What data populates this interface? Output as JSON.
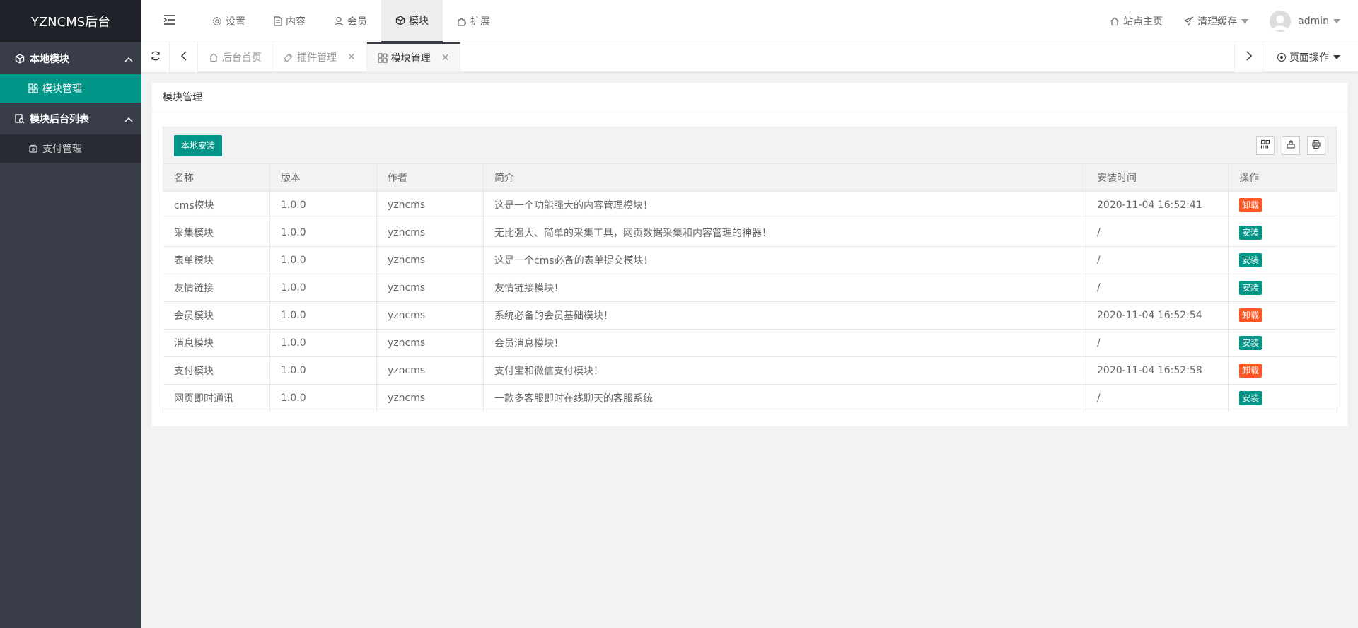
{
  "colors": {
    "accent": "#009688",
    "danger": "#ff5722",
    "sidebar_bg": "#393d49",
    "logo_bg": "#20222a"
  },
  "sidebar": {
    "logo": "YZNCMS后台",
    "groups": [
      {
        "title": "本地模块",
        "icon": "cube-icon",
        "items": [
          {
            "label": "模块管理",
            "icon": "apps-icon",
            "active": true
          }
        ]
      },
      {
        "title": "模块后台列表",
        "icon": "search-module-icon",
        "items": [
          {
            "label": "支付管理",
            "icon": "wallet-icon",
            "active": false
          }
        ]
      }
    ]
  },
  "header": {
    "menu": [
      {
        "label": "设置",
        "icon": "gear-icon"
      },
      {
        "label": "内容",
        "icon": "file-icon"
      },
      {
        "label": "会员",
        "icon": "user-icon"
      },
      {
        "label": "模块",
        "icon": "cube-icon",
        "active": true
      },
      {
        "label": "扩展",
        "icon": "puzzle-icon"
      }
    ],
    "right": {
      "home": "站点主页",
      "clear_cache": "清理缓存",
      "user": "admin"
    }
  },
  "tabbar": {
    "tabs": [
      {
        "label": "后台首页",
        "icon": "home-icon"
      },
      {
        "label": "插件管理",
        "icon": "plugin-icon"
      },
      {
        "label": "模块管理",
        "icon": "apps-icon",
        "active": true
      }
    ],
    "page_op": "页面操作"
  },
  "card": {
    "title": "模块管理",
    "local_install": "本地安装",
    "columns": [
      "名称",
      "版本",
      "作者",
      "简介",
      "安装时间",
      "操作"
    ],
    "rows": [
      {
        "name": "cms模块",
        "version": "1.0.0",
        "author": "yzncms",
        "desc": "这是一个功能强大的内容管理模块！",
        "time": "2020-11-04 16:52:41",
        "action": "卸载"
      },
      {
        "name": "采集模块",
        "version": "1.0.0",
        "author": "yzncms",
        "desc": "无比强大、简单的采集工具，网页数据采集和内容管理的神器！",
        "time": "/",
        "action": "安装"
      },
      {
        "name": "表单模块",
        "version": "1.0.0",
        "author": "yzncms",
        "desc": "这是一个cms必备的表单提交模块！",
        "time": "/",
        "action": "安装"
      },
      {
        "name": "友情链接",
        "version": "1.0.0",
        "author": "yzncms",
        "desc": "友情链接模块！",
        "time": "/",
        "action": "安装"
      },
      {
        "name": "会员模块",
        "version": "1.0.0",
        "author": "yzncms",
        "desc": "系统必备的会员基础模块！",
        "time": "2020-11-04 16:52:54",
        "action": "卸载"
      },
      {
        "name": "消息模块",
        "version": "1.0.0",
        "author": "yzncms",
        "desc": "会员消息模块！",
        "time": "/",
        "action": "安装"
      },
      {
        "name": "支付模块",
        "version": "1.0.0",
        "author": "yzncms",
        "desc": "支付宝和微信支付模块！",
        "time": "2020-11-04 16:52:58",
        "action": "卸载"
      },
      {
        "name": "网页即时通讯",
        "version": "1.0.0",
        "author": "yzncms",
        "desc": "一款多客服即时在线聊天的客服系统",
        "time": "/",
        "action": "安装"
      }
    ]
  }
}
